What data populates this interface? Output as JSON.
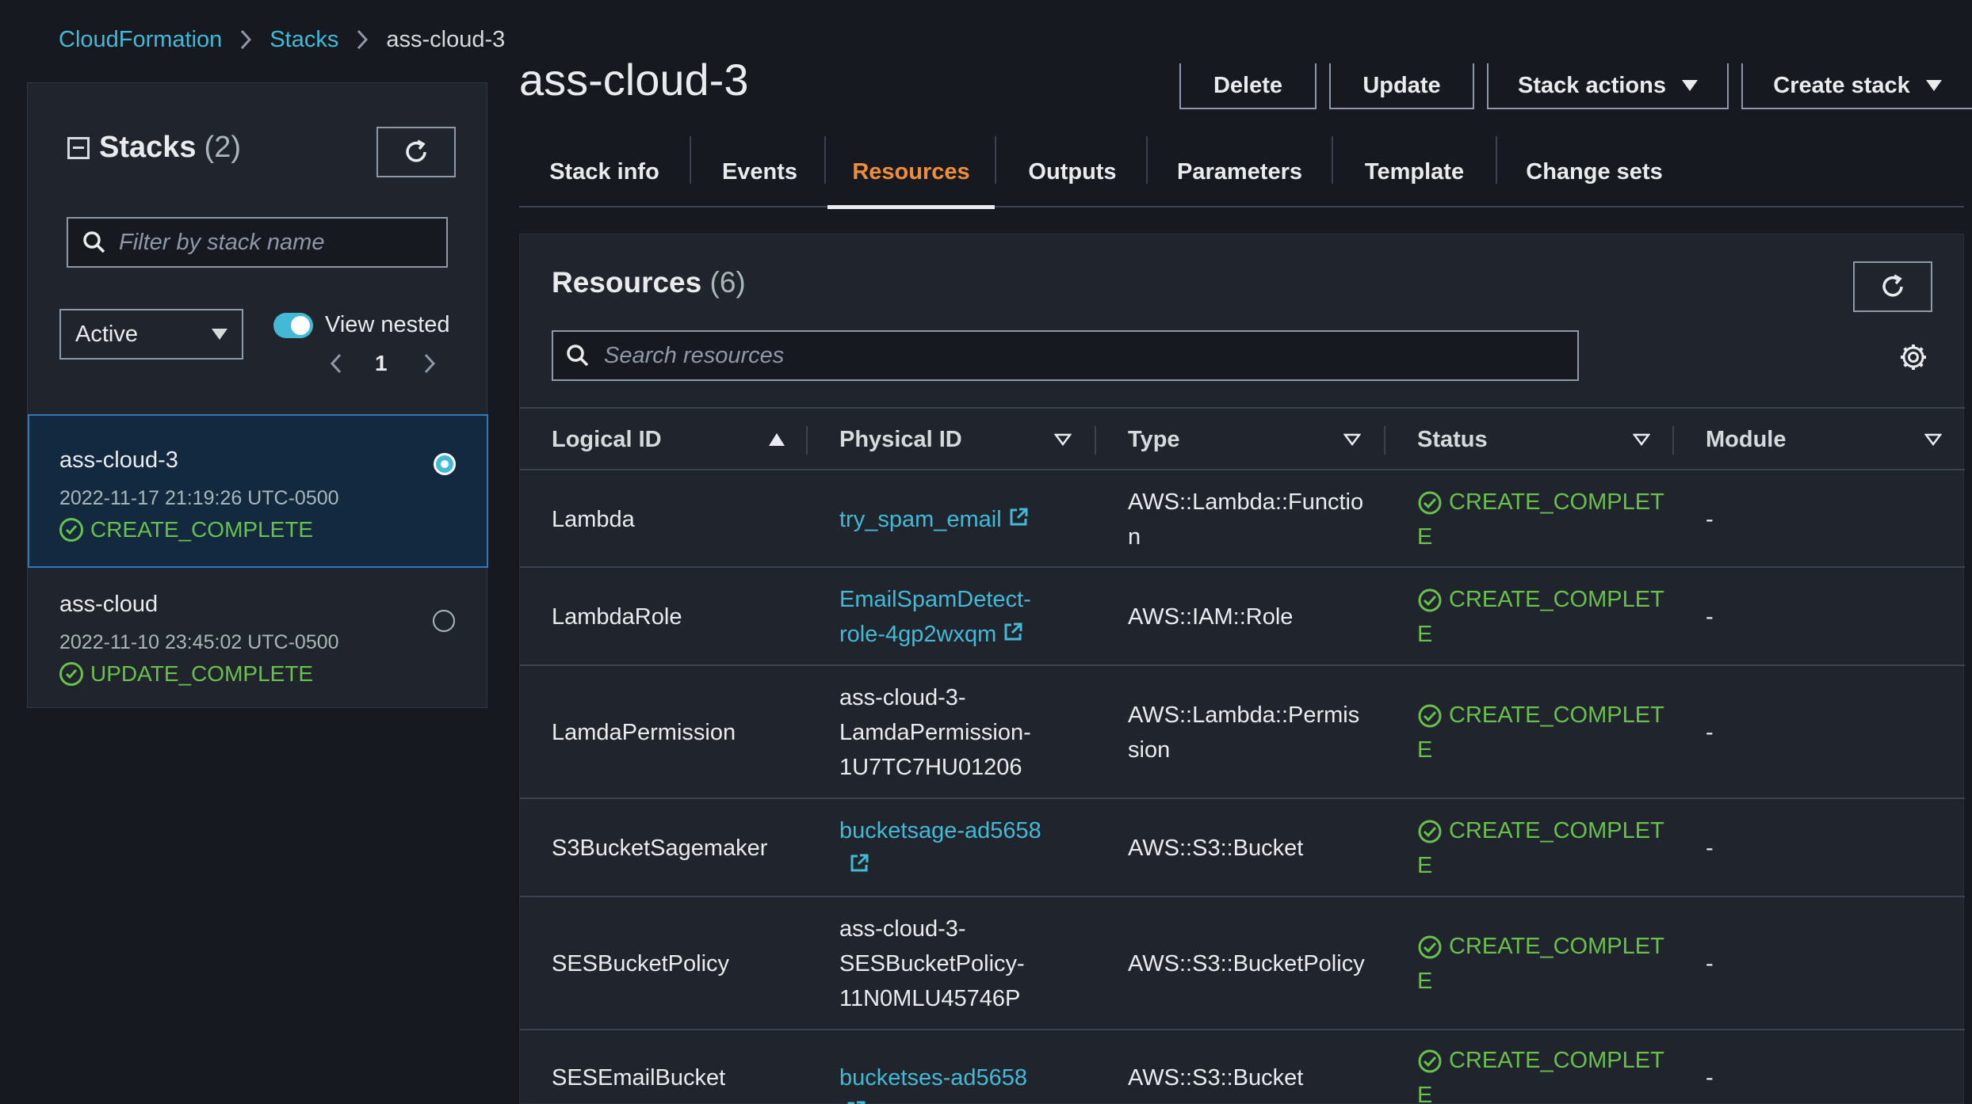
{
  "breadcrumb": {
    "root": "CloudFormation",
    "stacks": "Stacks",
    "current": "ass-cloud-3"
  },
  "sidebar": {
    "title": "Stacks",
    "count": "(2)",
    "filter_placeholder": "Filter by stack name",
    "status_filter": "Active",
    "view_nested_label": "View nested",
    "view_nested_on": true,
    "page": "1",
    "stacks": [
      {
        "name": "ass-cloud-3",
        "date": "2022-11-17 21:19:26 UTC-0500",
        "status": "CREATE_COMPLETE",
        "selected": true
      },
      {
        "name": "ass-cloud",
        "date": "2022-11-10 23:45:02 UTC-0500",
        "status": "UPDATE_COMPLETE",
        "selected": false
      }
    ]
  },
  "header": {
    "title": "ass-cloud-3",
    "buttons": {
      "delete": "Delete",
      "update": "Update",
      "stack_actions": "Stack actions",
      "create_stack": "Create stack"
    }
  },
  "tabs": [
    {
      "label": "Stack info"
    },
    {
      "label": "Events"
    },
    {
      "label": "Resources",
      "active": true
    },
    {
      "label": "Outputs"
    },
    {
      "label": "Parameters"
    },
    {
      "label": "Template"
    },
    {
      "label": "Change sets"
    }
  ],
  "resources": {
    "title": "Resources",
    "count": "(6)",
    "search_placeholder": "Search resources",
    "columns": [
      "Logical ID",
      "Physical ID",
      "Type",
      "Status",
      "Module"
    ],
    "rows": [
      {
        "logical_id": "Lambda",
        "physical_id": [
          "try_spam_email"
        ],
        "physical_link": true,
        "type": [
          "AWS::Lambda::Functio",
          "n"
        ],
        "status": [
          "CREATE_COMPLET",
          "E"
        ],
        "module": "-"
      },
      {
        "logical_id": "LambdaRole",
        "physical_id": [
          "EmailSpamDetect-",
          "role-4gp2wxqm"
        ],
        "physical_link": true,
        "type": [
          "AWS::IAM::Role"
        ],
        "status": [
          "CREATE_COMPLET",
          "E"
        ],
        "module": "-"
      },
      {
        "logical_id": "LamdaPermission",
        "physical_id": [
          "ass-cloud-3-",
          "LamdaPermission-",
          "1U7TC7HU01206"
        ],
        "physical_link": false,
        "type": [
          "AWS::Lambda::Permis",
          "sion"
        ],
        "status": [
          "CREATE_COMPLET",
          "E"
        ],
        "module": "-"
      },
      {
        "logical_id": "S3BucketSagemaker",
        "physical_id": [
          "bucketsage-ad5658"
        ],
        "physical_link": true,
        "type": [
          "AWS::S3::Bucket"
        ],
        "status": [
          "CREATE_COMPLET",
          "E"
        ],
        "module": "-"
      },
      {
        "logical_id": "SESBucketPolicy",
        "physical_id": [
          "ass-cloud-3-",
          "SESBucketPolicy-",
          "11N0MLU45746P"
        ],
        "physical_link": false,
        "type": [
          "AWS::S3::BucketPolicy"
        ],
        "status": [
          "CREATE_COMPLET",
          "E"
        ],
        "module": "-"
      },
      {
        "logical_id": "SESEmailBucket",
        "physical_id": [
          "bucketses-ad5658"
        ],
        "physical_link": true,
        "type": [
          "AWS::S3::Bucket"
        ],
        "status": [
          "CREATE_COMPLET",
          "E"
        ],
        "module": "-"
      }
    ]
  },
  "colors": {
    "background": "#16191f",
    "panel": "#20252d",
    "link": "#44b9d6",
    "success": "#69c04a",
    "active_tab": "#ee8d3a",
    "selected_border": "#2f79b8"
  }
}
